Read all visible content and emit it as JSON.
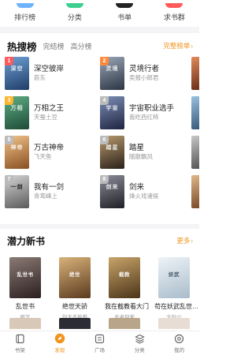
{
  "quick_nav": [
    {
      "label": "排行榜",
      "icon": "ranking-icon",
      "color": "#6fb3ff"
    },
    {
      "label": "分类",
      "icon": "category-icon",
      "color": "#3ccf8e"
    },
    {
      "label": "书单",
      "icon": "booklist-icon",
      "color": "#222222"
    },
    {
      "label": "求书群",
      "icon": "group-icon",
      "color": "#ff5b5b"
    }
  ],
  "hot": {
    "title": "热搜榜",
    "tabs": [
      "完结榜",
      "高分榜"
    ],
    "more": "完整榜单",
    "items": [
      {
        "rank": "1",
        "title": "深空彼岸",
        "author": "辰东",
        "cover_glyph": "深空",
        "cover_color": "#3a5f8a"
      },
      {
        "rank": "2",
        "title": "灵境行者",
        "author": "卖报小郎君",
        "cover_glyph": "灵境",
        "cover_color": "#4a5566"
      },
      {
        "rank": "3",
        "title": "万相之王",
        "author": "天蚕土豆",
        "cover_glyph": "万相",
        "cover_color": "#2f6b4f"
      },
      {
        "rank": "4",
        "title": "宇宙职业选手",
        "author": "我吃西红柿",
        "cover_glyph": "宇宙",
        "cover_color": "#3d4a6e"
      },
      {
        "rank": "5",
        "title": "万古神帝",
        "author": "飞天鱼",
        "cover_glyph": "神帝",
        "cover_color": "#c8874a"
      },
      {
        "rank": "6",
        "title": "踏星",
        "author": "随散飘风",
        "cover_glyph": "踏星",
        "cover_color": "#5b4a3a"
      },
      {
        "rank": "7",
        "title": "我有一剑",
        "author": "青鸾峰上",
        "cover_glyph": "一剑",
        "cover_color": "#8a8a8a"
      },
      {
        "rank": "8",
        "title": "剑来",
        "author": "烽火戏诸侯",
        "cover_glyph": "剑来",
        "cover_color": "#3e3e48"
      }
    ],
    "rank_colors": [
      "#ff5b5b",
      "#ff8a3d",
      "#ffb52e",
      "#bbbbbb"
    ]
  },
  "potential": {
    "title": "潜力新书",
    "more": "更多",
    "books": [
      {
        "title": "乱世书",
        "author": "姬叉",
        "cover_glyph": "乱世书",
        "cover_color": "#4b3a3a"
      },
      {
        "title": "绝世天骄",
        "author": "刘玉不能惹",
        "cover_glyph": "绝世",
        "cover_color": "#7a5a3a"
      },
      {
        "title": "我在截教看大门",
        "author": "无者何来",
        "cover_glyph": "截教",
        "cover_color": "#6b5432"
      },
      {
        "title": "苟在妖武乱世…",
        "author": "文钞公",
        "cover_glyph": "妖武",
        "cover_color": "#cfd9e2"
      }
    ]
  },
  "tabbar": [
    {
      "label": "书架",
      "icon": "bookshelf-icon",
      "active": false
    },
    {
      "label": "发现",
      "icon": "discover-icon",
      "active": true
    },
    {
      "label": "广场",
      "icon": "square-icon",
      "active": false
    },
    {
      "label": "分类",
      "icon": "category-tab-icon",
      "active": false
    },
    {
      "label": "我的",
      "icon": "profile-icon",
      "active": false
    }
  ],
  "accent_color": "#f0941e"
}
